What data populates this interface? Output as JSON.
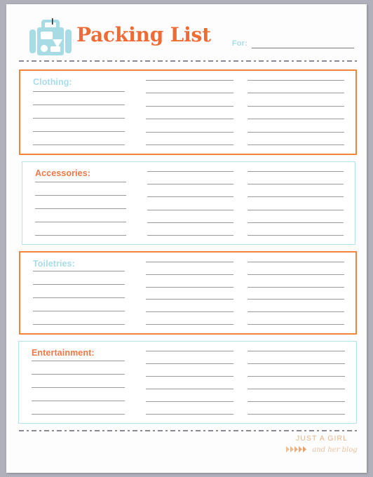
{
  "page": {
    "title": "Packing List",
    "logo_icon": "suitcase-icon",
    "accent_orange": "#ef6b33",
    "accent_blue": "#a8dcea",
    "line_color": "#9a9a9a",
    "paper_color": "#fdfdfd",
    "background_color": "#b0b0bb"
  },
  "header": {
    "title": "Packing List",
    "for_label": "For:",
    "for_value": ""
  },
  "sections": [
    {
      "label": "Clothing:",
      "label_color": "#a8dcea",
      "border_color": "#f4833c",
      "border_style": "orange",
      "columns": [
        {
          "lines": 5,
          "has_label": true
        },
        {
          "lines": 6,
          "has_label": false
        },
        {
          "lines": 6,
          "has_label": false
        }
      ]
    },
    {
      "label": "Accessories:",
      "label_color": "#ef7847",
      "border_color": "#b5e2ee",
      "border_style": "blue",
      "columns": [
        {
          "lines": 5,
          "has_label": true
        },
        {
          "lines": 6,
          "has_label": false
        },
        {
          "lines": 6,
          "has_label": false
        }
      ]
    },
    {
      "label": "Toiletries:",
      "label_color": "#a8dcea",
      "border_color": "#f4833c",
      "border_style": "orange",
      "columns": [
        {
          "lines": 5,
          "has_label": true
        },
        {
          "lines": 6,
          "has_label": false
        },
        {
          "lines": 6,
          "has_label": false
        }
      ]
    },
    {
      "label": "Entertainment:",
      "label_color": "#ef7847",
      "border_color": "#b5e2ee",
      "border_style": "blue",
      "columns": [
        {
          "lines": 5,
          "has_label": true
        },
        {
          "lines": 6,
          "has_label": false
        },
        {
          "lines": 6,
          "has_label": false
        }
      ]
    }
  ],
  "footer": {
    "brand_top": "JUST A GIRL",
    "brand_bottom": "and her blog",
    "brand_icon": "chevron-arrows-icon",
    "brand_color": "#e8b488"
  }
}
